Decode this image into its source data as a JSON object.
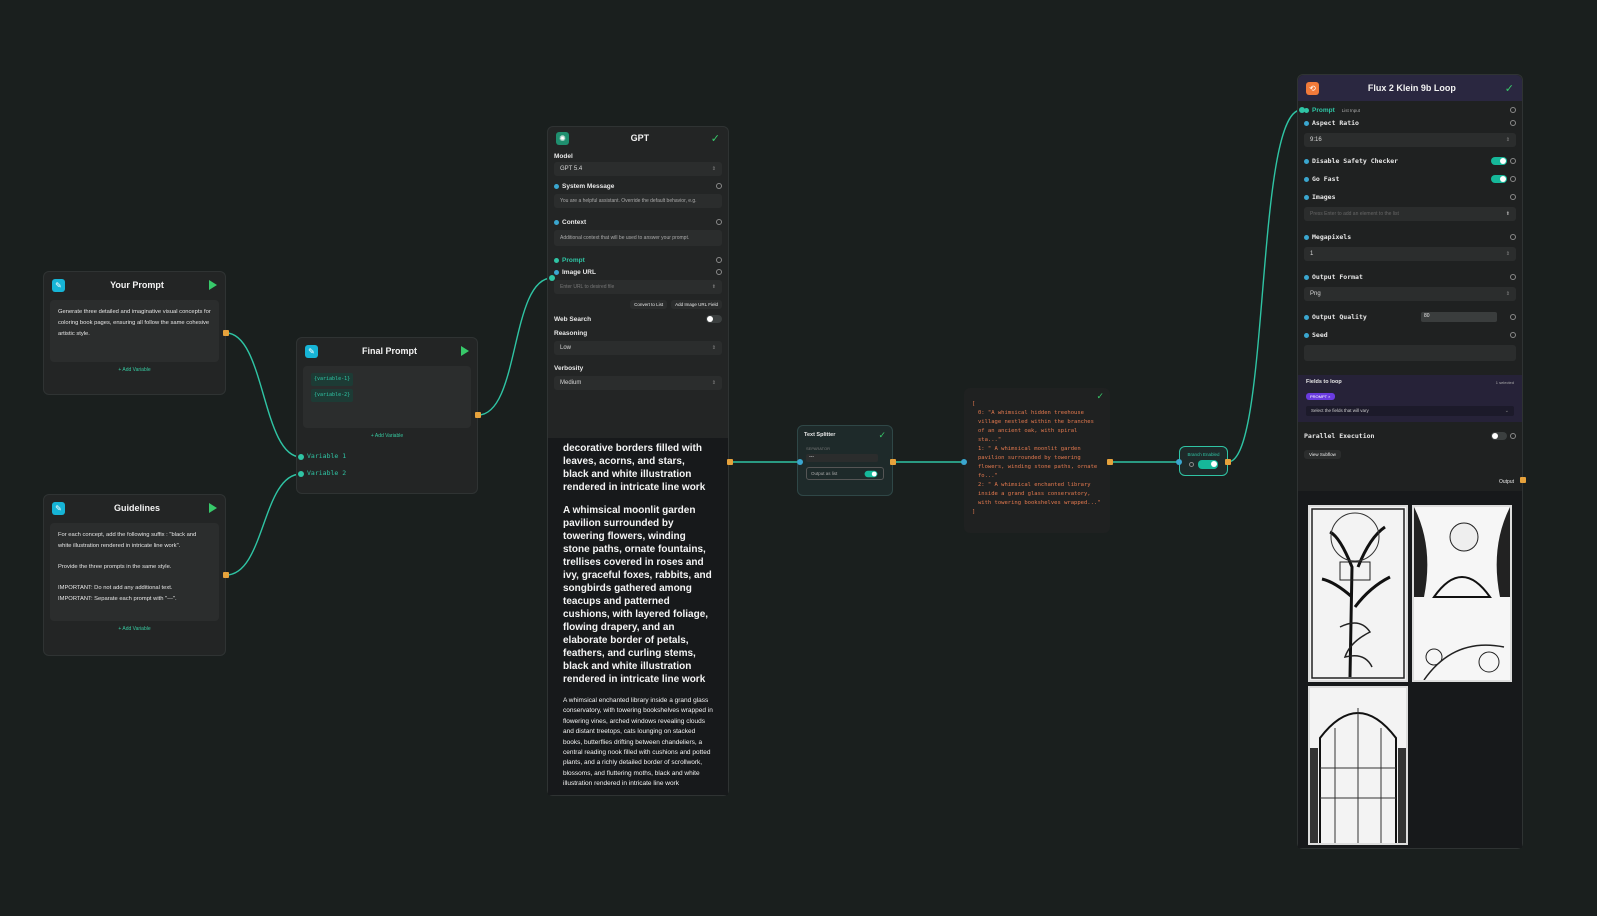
{
  "your_prompt": {
    "title": "Your Prompt",
    "text": "Generate three detailed and imaginative visual concepts for coloring book pages, ensuring all follow the same cohesive artistic style.",
    "add_variable": "+ Add Variable"
  },
  "guidelines": {
    "title": "Guidelines",
    "line1": "For each concept, add the following suffix : \"black and white illustration rendered in intricate line work\".",
    "line2": "Provide the three prompts in the same style.",
    "line3": "IMPORTANT: Do not add any additional text.",
    "line4": "IMPORTANT: Separate each prompt with \"---\".",
    "add_variable": "+ Add Variable"
  },
  "final_prompt": {
    "title": "Final Prompt",
    "var1_tag": "{variable-1}",
    "var2_tag": "{variable-2}",
    "add_variable": "+ Add Variable",
    "input1": "Variable 1",
    "input2": "Variable 2"
  },
  "gpt": {
    "title": "GPT",
    "model_label": "Model",
    "model_value": "GPT 5.4",
    "system_label": "System Message",
    "system_value": "You are a helpful assistant. Override the default behavior, e.g.",
    "context_label": "Context",
    "context_value": "Additional context that will be used to answer your prompt.",
    "prompt_label": "Prompt",
    "image_label": "Image URL",
    "image_placeholder": "Enter URL to desired file",
    "convert_btn": "Convert to List",
    "add_image_btn": "Add Image URL Field",
    "web_search_label": "Web Search",
    "reasoning_label": "Reasoning",
    "reasoning_value": "Low",
    "verbosity_label": "Verbosity",
    "verbosity_value": "Medium",
    "output_p1": "decorative borders filled with leaves, acorns, and stars, black and white illustration rendered in intricate line work",
    "output_p2": "A whimsical moonlit garden pavilion surrounded by towering flowers, winding stone paths, ornate fountains, trellises covered in roses and ivy, graceful foxes, rabbits, and songbirds gathered among teacups and patterned cushions, with layered foliage, flowing drapery, and an elaborate border of petals, feathers, and curling stems, black and white illustration rendered in intricate line work",
    "output_p3": "A whimsical enchanted library inside a grand glass conservatory, with towering bookshelves wrapped in flowering vines, arched windows revealing clouds and distant treetops, cats lounging on stacked books, butterflies drifting between chandeliers, a central reading nook filled with cushions and potted plants, and a richly detailed border of scrollwork, blossoms, and fluttering moths, black and white illustration rendered in intricate line work"
  },
  "splitter": {
    "title": "Text Splitter",
    "sep_label": "SEPARATOR",
    "sep_value": "---",
    "output_list_label": "Output as list"
  },
  "json_output": {
    "open": "[",
    "item0": "0: \"A whimsical hidden treehouse village nestled within the branches of an ancient oak, with spiral sta...\"",
    "item1": "1: \" A whimsical moonlit garden pavilion surrounded by towering flowers, winding stone paths, ornate fo...\"",
    "item2": "2: \" A whimsical enchanted library inside a grand glass conservatory, with towering bookshelves wrapped...\"",
    "close": "]"
  },
  "branch": {
    "label": "Branch Enabled"
  },
  "flux": {
    "title": "Flux 2 Klein 9b Loop",
    "prompt_label": "Prompt",
    "list_input": "List Input",
    "aspect_label": "Aspect Ratio",
    "aspect_value": "9:16",
    "safety_label": "Disable Safety Checker",
    "gofast_label": "Go Fast",
    "images_label": "Images",
    "images_placeholder": "Press Enter to add an element to the list",
    "megapixels_label": "Megapixels",
    "megapixels_value": "1",
    "format_label": "Output Format",
    "format_value": "Png",
    "quality_label": "Output Quality",
    "quality_value": "80",
    "seed_label": "Seed",
    "fields_loop_label": "Fields to loop",
    "fields_loop_count": "1 selected",
    "prompt_chip": "PROMPT ×",
    "fields_select": "Select the fields that will vary",
    "parallel_label": "Parallel Execution",
    "view_subflow": "View Subflow",
    "output_label": "Output"
  },
  "colors": {
    "canvas": "#1a1f1e",
    "node": "#232525",
    "accent_teal": "#2fc4a4",
    "accent_orange": "#e6a23c",
    "accent_green": "#37c96a",
    "flux_header": "#2a2740"
  }
}
